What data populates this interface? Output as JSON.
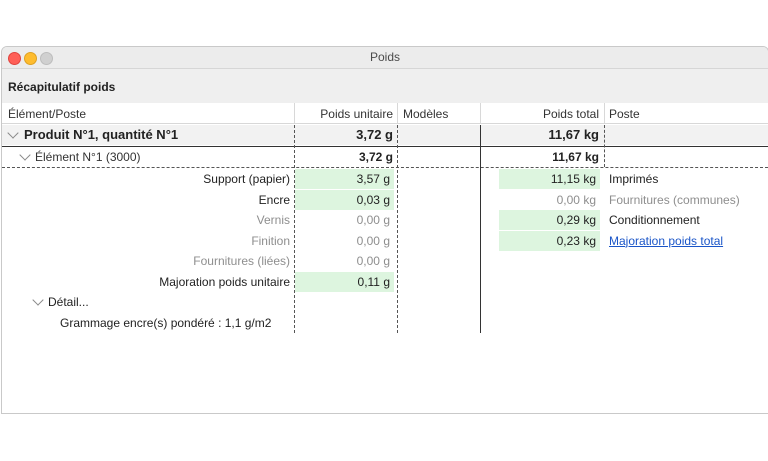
{
  "window": {
    "title": "Poids"
  },
  "section_title": "Récapitulatif poids",
  "columns": {
    "element": "Élément/Poste",
    "unit_weight": "Poids unitaire",
    "models": "Modèles",
    "total_weight": "Poids total",
    "post": "Poste"
  },
  "product_row": {
    "label": "Produit N°1, quantité N°1",
    "unit": "3,72 g",
    "total": "11,67 kg"
  },
  "element_row": {
    "label": "Élément N°1 (3000)",
    "unit": "3,72 g",
    "total": "11,67 kg"
  },
  "left_rows": [
    {
      "label": "Support (papier)",
      "value": "3,57 g",
      "active": true
    },
    {
      "label": "Encre",
      "value": "0,03 g",
      "active": true
    },
    {
      "label": "Vernis",
      "value": "0,00 g",
      "active": false
    },
    {
      "label": "Finition",
      "value": "0,00 g",
      "active": false
    },
    {
      "label": "Fournitures (liées)",
      "value": "0,00 g",
      "active": false
    },
    {
      "label": "Majoration poids unitaire",
      "value": "0,11 g",
      "active": true
    }
  ],
  "right_rows": [
    {
      "value": "11,15 kg",
      "post": "Imprimés",
      "active": true,
      "link": false
    },
    {
      "value": "0,00 kg",
      "post": "Fournitures (communes)",
      "active": false,
      "link": false
    },
    {
      "value": "0,29 kg",
      "post": "Conditionnement",
      "active": true,
      "link": false
    },
    {
      "value": "0,23 kg",
      "post": "Majoration poids total",
      "active": true,
      "link": true
    }
  ],
  "detail": {
    "label": "Détail...",
    "text": "Grammage encre(s) pondéré : 1,1 g/m2"
  }
}
